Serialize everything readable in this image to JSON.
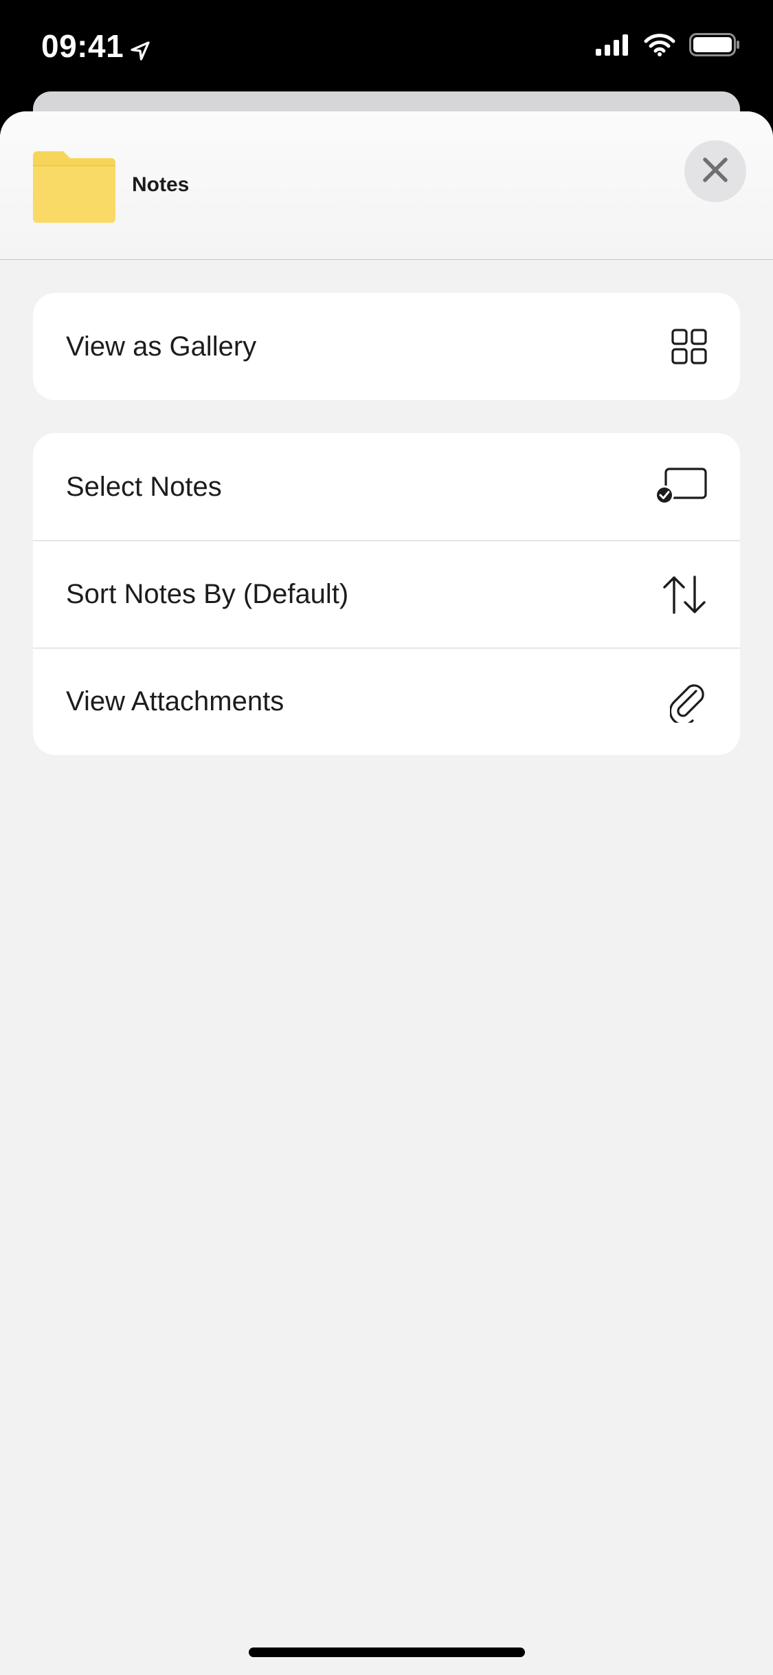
{
  "status_bar": {
    "time": "09:41",
    "icons": [
      "location-arrow-icon",
      "cellular-signal-icon",
      "wifi-icon",
      "battery-icon"
    ]
  },
  "sheet": {
    "title": "Notes",
    "folder_color": "#F9D85F",
    "close_icon": "close-icon"
  },
  "menu": {
    "group1": [
      {
        "label": "View as Gallery",
        "icon": "gallery-grid-icon"
      }
    ],
    "group2": [
      {
        "label": "Select Notes",
        "icon": "select-checkmark-icon"
      },
      {
        "label": "Sort Notes By (Default)",
        "icon": "sort-arrows-icon"
      },
      {
        "label": "View Attachments",
        "icon": "paperclip-icon"
      }
    ]
  }
}
